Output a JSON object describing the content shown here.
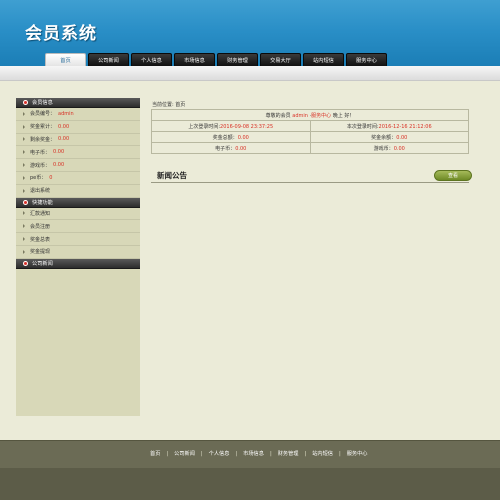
{
  "header": {
    "brand": "会员系统",
    "nav": [
      "首页",
      "公司新闻",
      "个人信息",
      "市场信息",
      "财务管理",
      "交易大厅",
      "站内短信",
      "服务中心"
    ]
  },
  "sidebar": {
    "sections": [
      {
        "title": "会员信息",
        "items": [
          {
            "label": "会员编号：",
            "value": "admin"
          },
          {
            "label": "奖金累计：",
            "value": "0.00"
          },
          {
            "label": "剩余奖金：",
            "value": "0.00"
          },
          {
            "label": "电子币：",
            "value": "0.00"
          },
          {
            "label": "游戏币：",
            "value": "0.00"
          },
          {
            "label": "pe币：",
            "value": "0"
          },
          {
            "label": "退出系统",
            "value": ""
          }
        ]
      },
      {
        "title": "快捷功能",
        "items": [
          {
            "label": "汇款通知",
            "value": ""
          },
          {
            "label": "会员注册",
            "value": ""
          },
          {
            "label": "奖金总表",
            "value": ""
          },
          {
            "label": "奖金提现",
            "value": ""
          }
        ]
      },
      {
        "title": "公司新闻",
        "items": []
      }
    ]
  },
  "content": {
    "crumb": "当前位置: 首页",
    "greeting_prefix": "尊敬的会员 ",
    "greeting_user": "admin",
    "greeting_mid": " ·",
    "greeting_link": "服务中心",
    "greeting_suffix": " 晚上 好！",
    "last_login_label": "上次登录时间:",
    "last_login_value": "2016-09-08 23:37:25",
    "this_login_label": "本次登录时间:",
    "this_login_value": "2016-12-16 21:12:06",
    "bonus_total_label": "奖金总额：",
    "bonus_total_value": "0.00",
    "bonus_left_label": "奖金余额：",
    "bonus_left_value": "0.00",
    "ecoin_label": "电子币：",
    "ecoin_value": "0.00",
    "gcoin_label": "游戏币：",
    "gcoin_value": "0.00",
    "news_title": "新闻公告",
    "view_button": "查看"
  },
  "footer": {
    "links": [
      "首页",
      "公司新闻",
      "个人信息",
      "市场信息",
      "财务管理",
      "站内短信",
      "服务中心"
    ],
    "separator": "|"
  }
}
